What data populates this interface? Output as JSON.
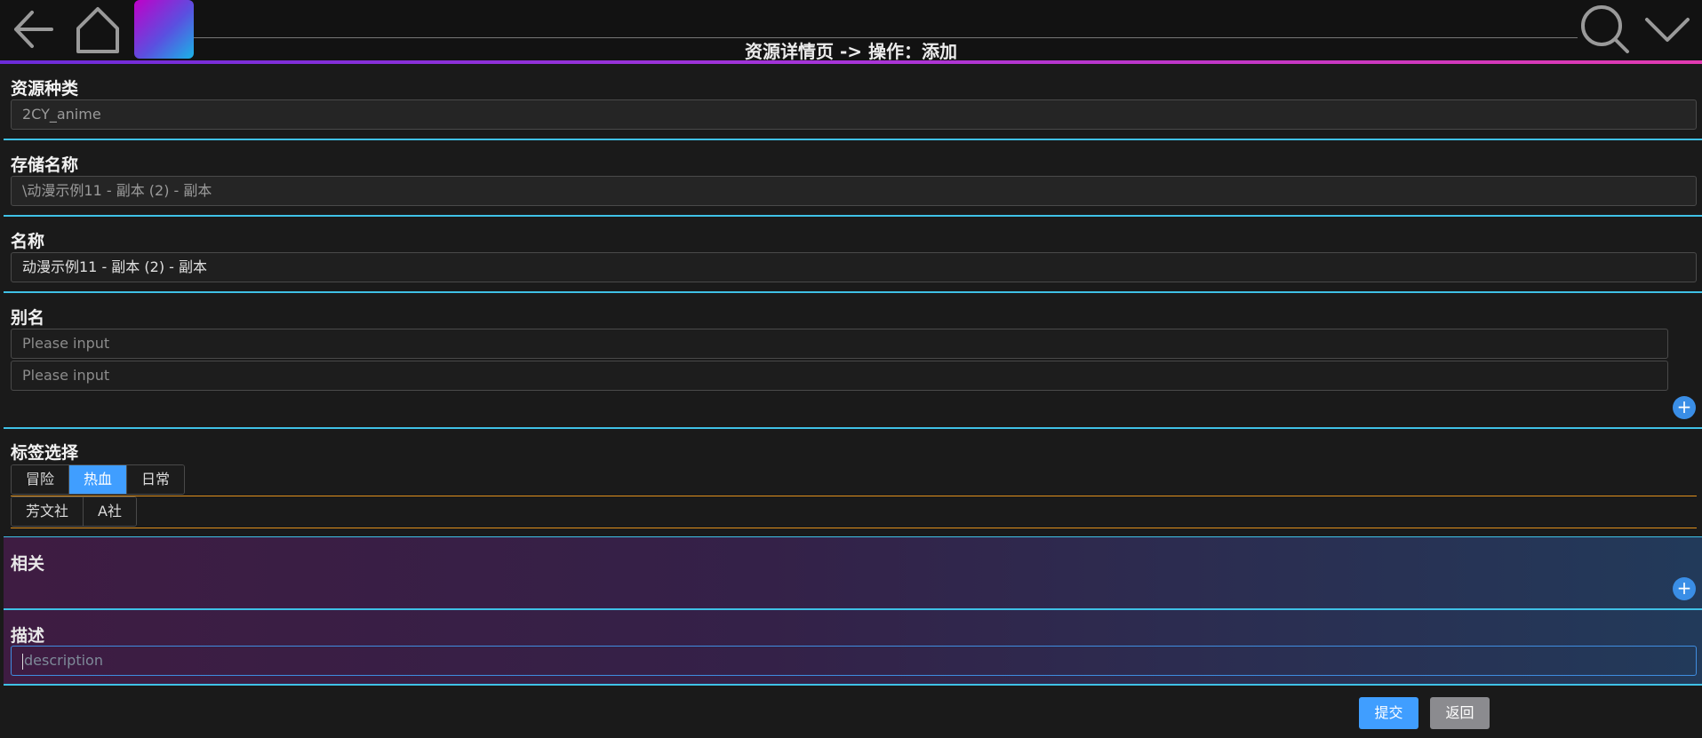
{
  "header": {
    "title": "资源详情页 -> 操作：添加",
    "icons": [
      "back-arrow-icon",
      "home-icon",
      "app-logo",
      "search-icon",
      "chevron-down-icon"
    ]
  },
  "form": {
    "resource_type": {
      "label": "资源种类",
      "value": "2CY_anime"
    },
    "storage_name": {
      "label": "存储名称",
      "value": "\\动漫示例11 - 副本 (2) - 副本"
    },
    "name": {
      "label": "名称",
      "value": "动漫示例11 - 副本 (2) - 副本"
    },
    "alias": {
      "label": "别名",
      "inputs": [
        {
          "placeholder": "Please input"
        },
        {
          "placeholder": "Please input"
        }
      ],
      "add_symbol": "+"
    },
    "tags": {
      "label": "标签选择",
      "group1": [
        {
          "text": "冒险",
          "selected": false
        },
        {
          "text": "热血",
          "selected": true
        },
        {
          "text": "日常",
          "selected": false
        }
      ],
      "group2": [
        {
          "text": "芳文社",
          "selected": false
        },
        {
          "text": "A社",
          "selected": false
        }
      ]
    },
    "related": {
      "label": "相关",
      "add_symbol": "+"
    },
    "description": {
      "label": "描述",
      "placeholder": "description"
    }
  },
  "actions": {
    "submit": "提交",
    "back": "返回"
  },
  "colors": {
    "accent": "#409eff",
    "divider": "#3fc1e6",
    "tag_line": "#e0901c"
  }
}
